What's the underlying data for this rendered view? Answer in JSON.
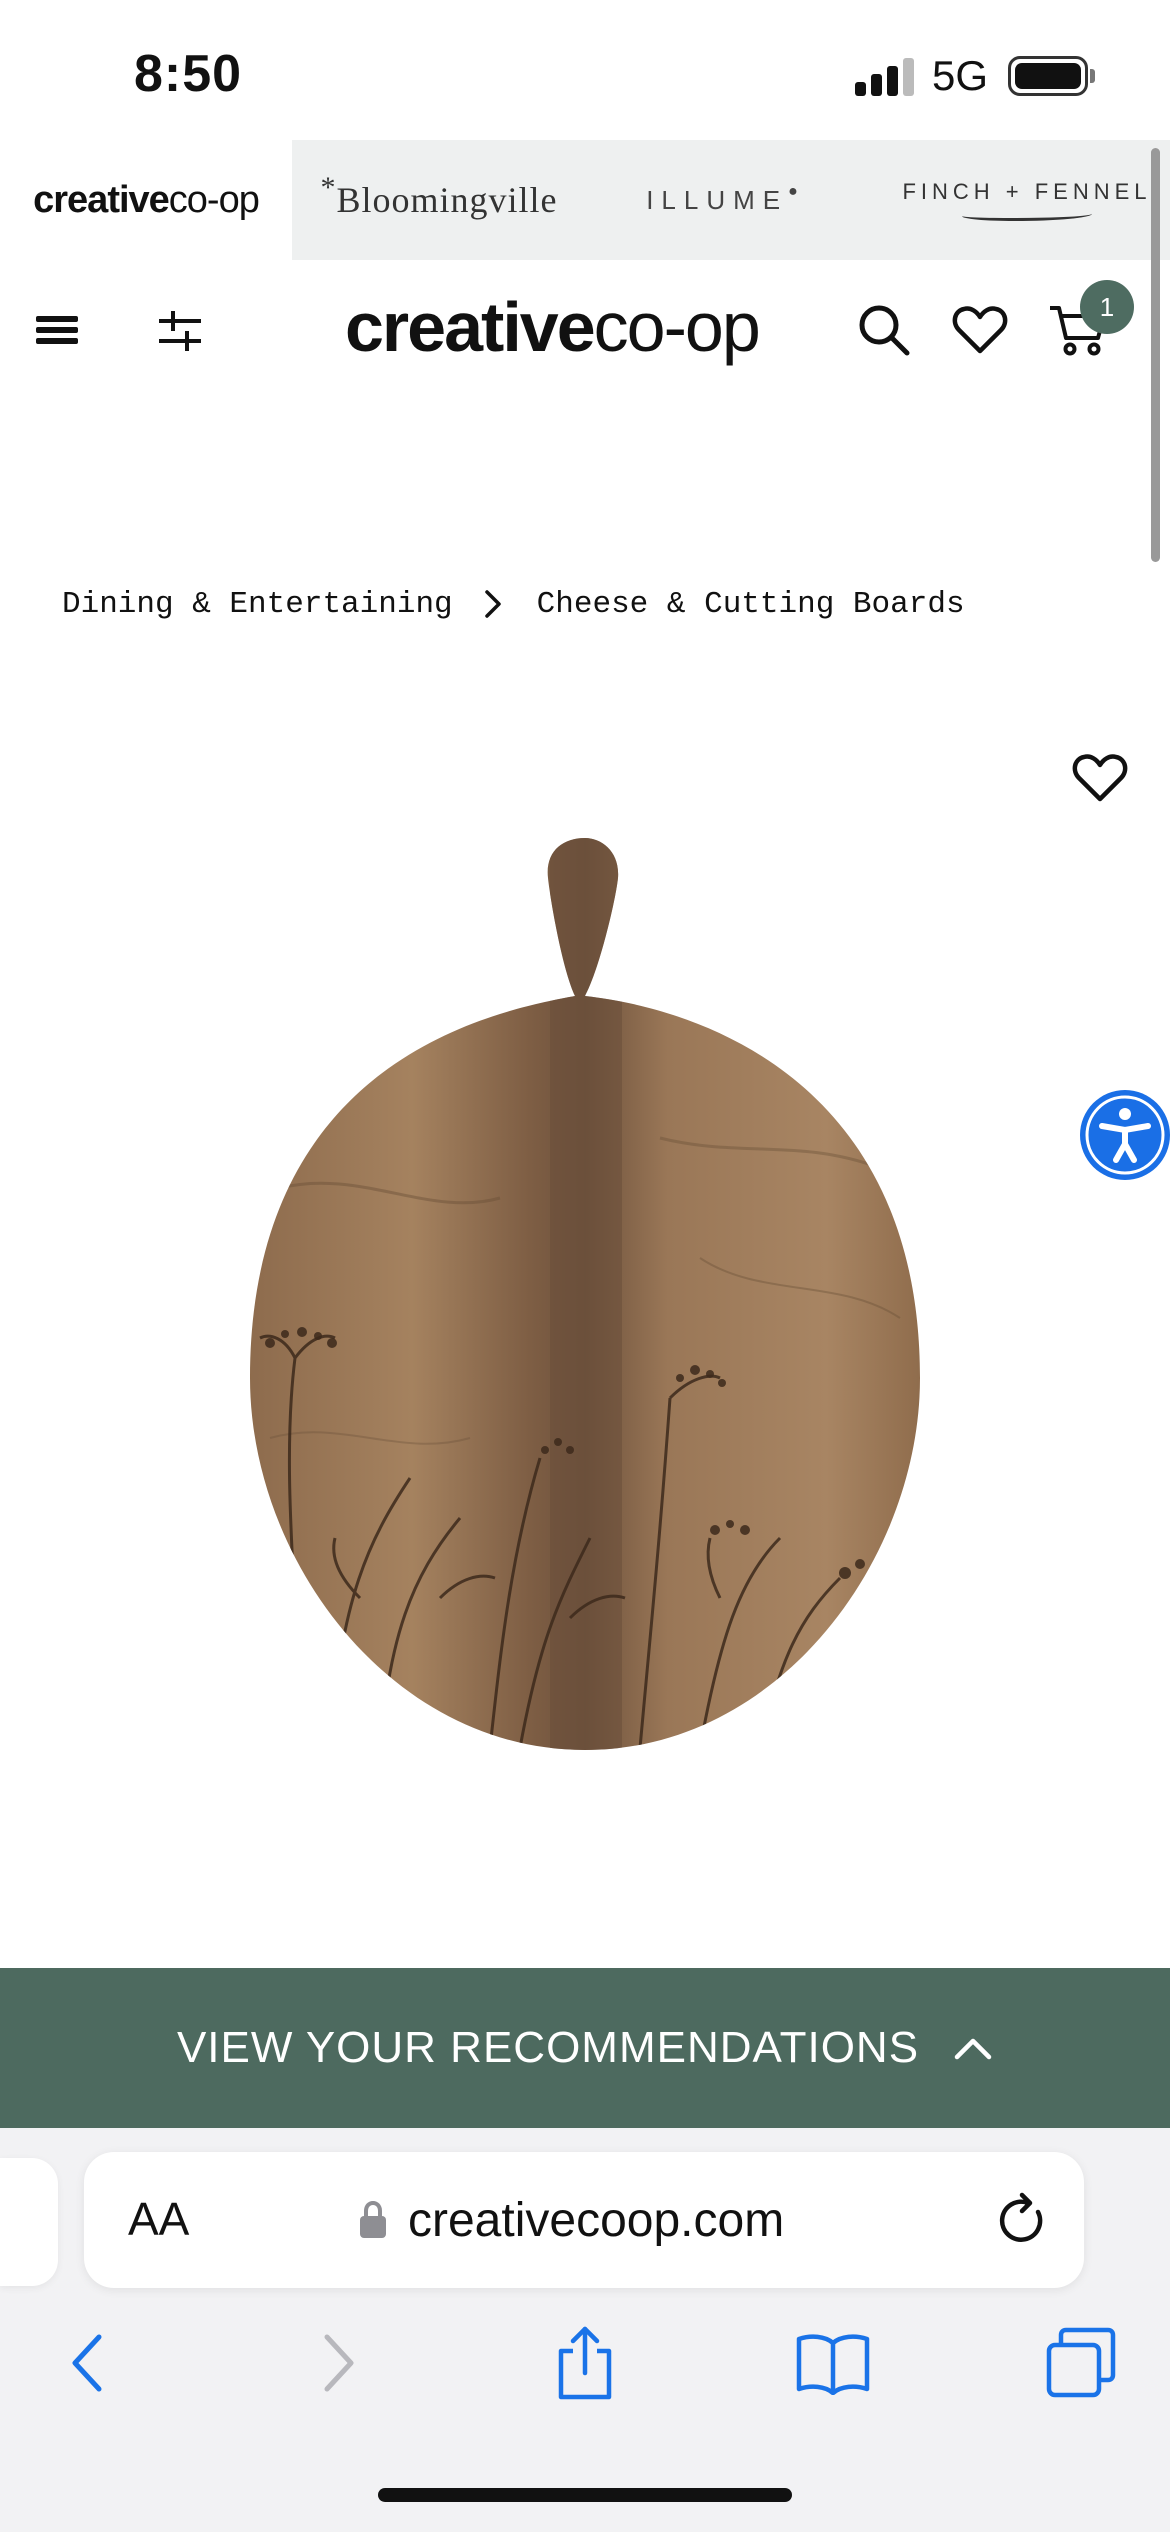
{
  "status_bar": {
    "time": "8:50",
    "network": "5G"
  },
  "brand_strip": {
    "creative_bold": "creative",
    "creative_light": "co-op",
    "bloomingville": "Bloomingville",
    "illume": "ILLUME",
    "finch_fennel": "FINCH + FENNEL"
  },
  "header": {
    "logo_bold": "creative",
    "logo_light": "co-op",
    "cart_count": "1"
  },
  "breadcrumb": {
    "items": [
      "Dining & Entertaining",
      "Cheese & Cutting Boards"
    ]
  },
  "recommendations": {
    "label": "VIEW YOUR RECOMMENDATIONS"
  },
  "safari": {
    "text_size_label": "AA",
    "url": "creativecoop.com"
  },
  "colors": {
    "brand_green": "#4d6a5f",
    "accessibility_blue": "#1a6fe6",
    "safari_blue": "#1a73e8"
  },
  "icons": {
    "header": [
      "menu-icon",
      "filter-icon",
      "search-icon",
      "heart-icon",
      "cart-icon"
    ],
    "toolbar": [
      "back-icon",
      "forward-icon",
      "share-icon",
      "bookmarks-icon",
      "tabs-icon"
    ]
  }
}
